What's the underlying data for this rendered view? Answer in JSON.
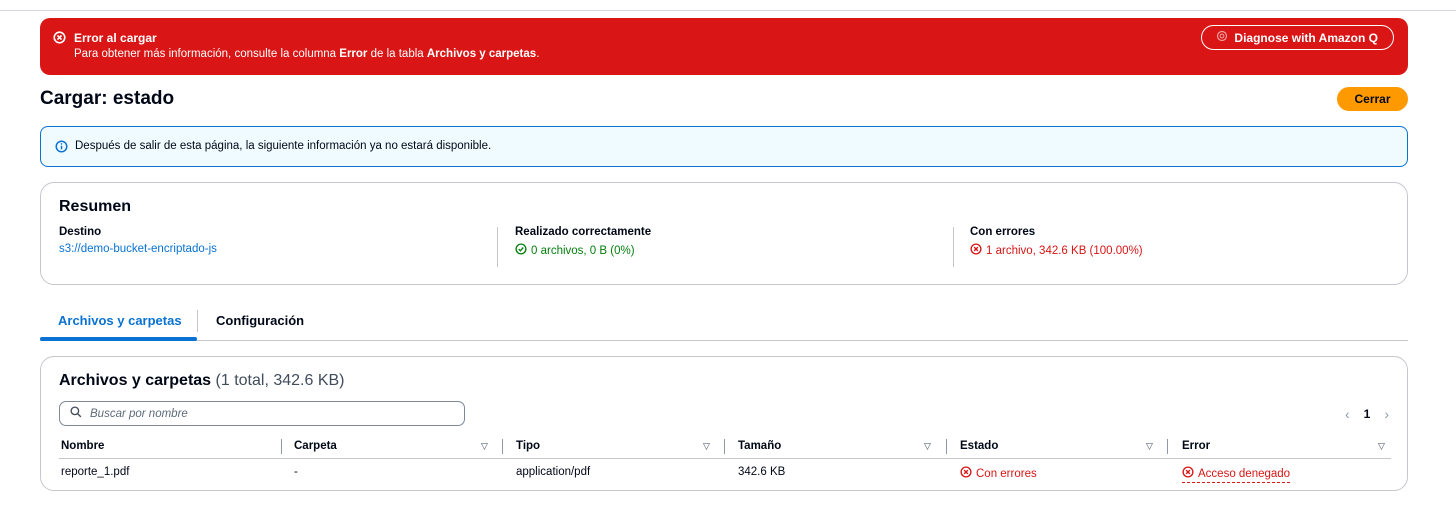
{
  "error_banner": {
    "title": "Error al cargar",
    "message_pre": "Para obtener más información, consulte la columna ",
    "message_bold1": "Error",
    "message_mid": " de la tabla ",
    "message_bold2": "Archivos y carpetas",
    "message_post": ".",
    "diagnose_label": "Diagnose with Amazon Q"
  },
  "header": {
    "title": "Cargar: estado",
    "close_label": "Cerrar"
  },
  "info_banner": {
    "text": "Después de salir de esta página, la siguiente información ya no estará disponible."
  },
  "summary": {
    "title": "Resumen",
    "destination_label": "Destino",
    "destination_value": "s3://demo-bucket-encriptado-js",
    "success_label": "Realizado correctamente",
    "success_value": "0 archivos, 0 B (0%)",
    "failed_label": "Con errores",
    "failed_value": "1 archivo, 342.6 KB (100.00%)"
  },
  "tabs": [
    {
      "label": "Archivos y carpetas",
      "active": true
    },
    {
      "label": "Configuración",
      "active": false
    }
  ],
  "files": {
    "title": "Archivos y carpetas",
    "count": "(1 total, 342.6 KB)",
    "search_placeholder": "Buscar por nombre",
    "page": "1",
    "columns": [
      "Nombre",
      "Carpeta",
      "Tipo",
      "Tamaño",
      "Estado",
      "Error"
    ],
    "rows": [
      {
        "name": "reporte_1.pdf",
        "folder": "-",
        "type": "application/pdf",
        "size": "342.6 KB",
        "status": "Con errores",
        "error": "Acceso denegado"
      }
    ]
  },
  "colors": {
    "error_red": "#d91515",
    "link_blue": "#0972d3",
    "success_green": "#037f0c",
    "primary_orange": "#ff9900"
  }
}
